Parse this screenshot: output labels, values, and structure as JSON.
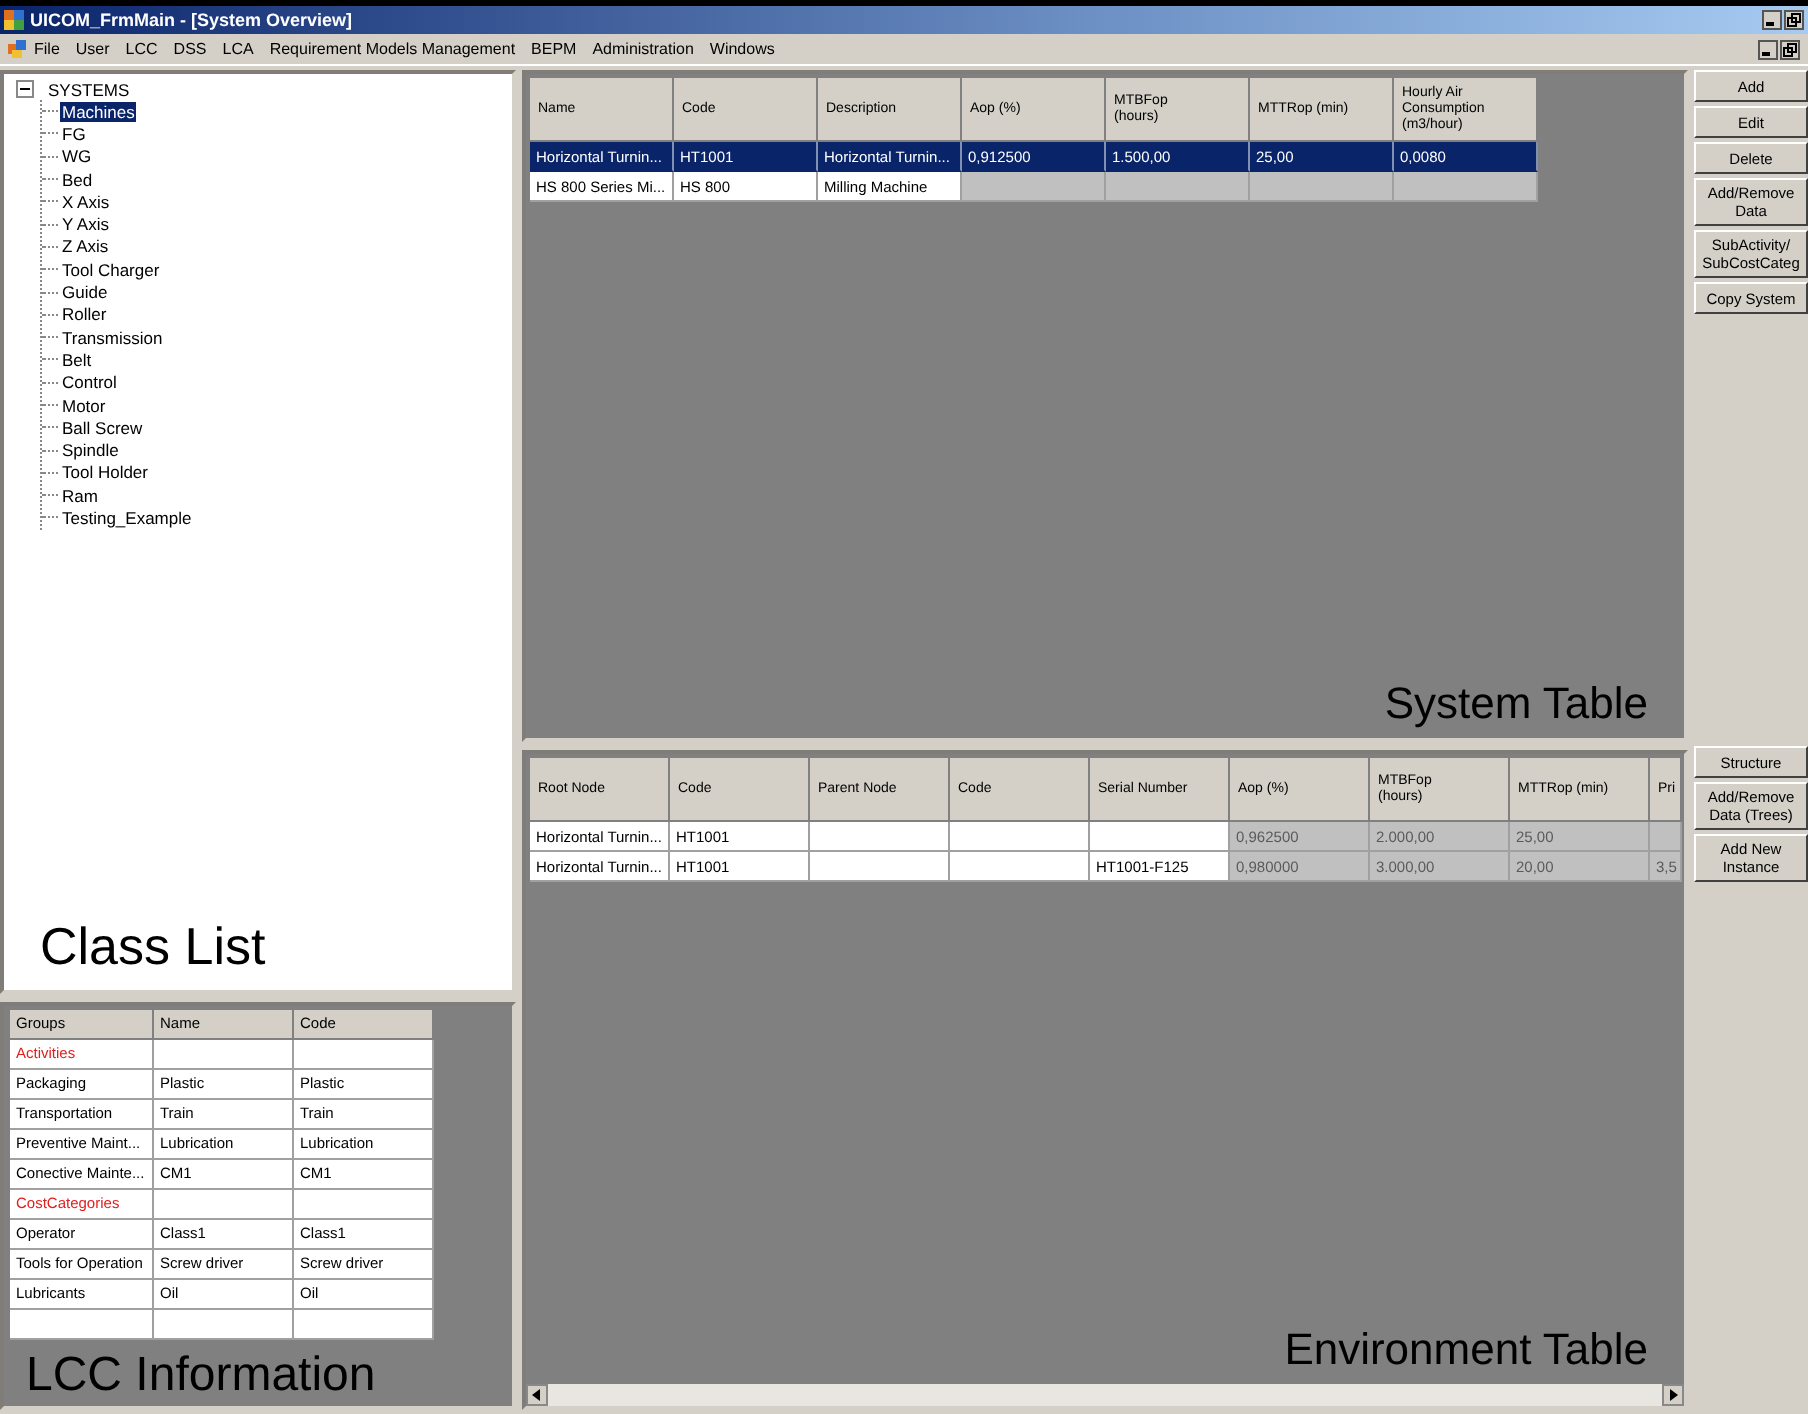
{
  "window": {
    "title": "UICOM_FrmMain - [System Overview]"
  },
  "menu": [
    "File",
    "User",
    "LCC",
    "DSS",
    "LCA",
    "Requirement Models Management",
    "BEPM",
    "Administration",
    "Windows"
  ],
  "class_list": {
    "label": "Class List",
    "tree": {
      "label": "SYSTEMS",
      "expanded": true,
      "children": [
        {
          "label": "Machines",
          "selected": true
        },
        {
          "label": "FG",
          "selected": false
        },
        {
          "label": "WG",
          "selected": false
        },
        {
          "label": "Bed",
          "selected": false
        },
        {
          "label": "X Axis",
          "selected": false
        },
        {
          "label": "Y Axis",
          "selected": false
        },
        {
          "label": "Z Axis",
          "selected": false
        },
        {
          "label": "Tool Charger",
          "selected": false
        },
        {
          "label": "Guide",
          "selected": false
        },
        {
          "label": "Roller",
          "selected": false
        },
        {
          "label": "Transmission",
          "selected": false
        },
        {
          "label": "Belt",
          "selected": false
        },
        {
          "label": "Control",
          "selected": false
        },
        {
          "label": "Motor",
          "selected": false
        },
        {
          "label": "Ball Screw",
          "selected": false
        },
        {
          "label": "Spindle",
          "selected": false
        },
        {
          "label": "Tool Holder",
          "selected": false
        },
        {
          "label": "Ram",
          "selected": false
        },
        {
          "label": "Testing_Example",
          "selected": false
        }
      ]
    }
  },
  "system_table": {
    "label": "System Table",
    "columns": [
      "Name",
      "Code",
      "Description",
      "Aop (%)",
      "MTBFop\n(hours)",
      "MTTRop (min)",
      "Hourly Air\nConsumption\n(m3/hour)"
    ],
    "rows": [
      {
        "selected": true,
        "cells": [
          {
            "text": "Horizontal Turnin...",
            "locked": false
          },
          {
            "text": "HT1001",
            "locked": false
          },
          {
            "text": "Horizontal Turnin...",
            "locked": false
          },
          {
            "text": "0,912500",
            "locked": false
          },
          {
            "text": "1.500,00",
            "locked": false
          },
          {
            "text": "25,00",
            "locked": false
          },
          {
            "text": "0,0080",
            "locked": false
          }
        ]
      },
      {
        "selected": false,
        "cells": [
          {
            "text": "HS 800 Series Mi...",
            "locked": false
          },
          {
            "text": "HS 800",
            "locked": false
          },
          {
            "text": "Milling Machine",
            "locked": false
          },
          {
            "locked": true
          },
          {
            "locked": true
          },
          {
            "locked": true
          },
          {
            "locked": true
          }
        ]
      }
    ]
  },
  "system_buttons": [
    "Add",
    "Edit",
    "Delete",
    "Add/Remove Data",
    "SubActivity/ SubCostCateg",
    "Copy System"
  ],
  "environment_table": {
    "label": "Environment Table",
    "columns": [
      "Root Node",
      "Code",
      "Parent Node",
      "Code",
      "Serial Number",
      "Aop (%)",
      "MTBFop\n(hours)",
      "MTTRop (min)",
      "Pri"
    ],
    "rows": [
      {
        "selected": false,
        "cells": [
          {
            "text": "Horizontal Turnin...",
            "locked": false
          },
          {
            "text": "HT1001",
            "locked": false
          },
          {
            "locked": false
          },
          {
            "locked": false
          },
          {
            "locked": false
          },
          {
            "text": "0,962500",
            "locked": true
          },
          {
            "text": "2.000,00",
            "locked": true
          },
          {
            "text": "25,00",
            "locked": true
          },
          {
            "locked": true
          }
        ]
      },
      {
        "selected": false,
        "cells": [
          {
            "text": "Horizontal Turnin...",
            "locked": false
          },
          {
            "text": "HT1001",
            "locked": false
          },
          {
            "locked": false
          },
          {
            "locked": false
          },
          {
            "text": "HT1001-F125",
            "locked": false
          },
          {
            "text": "0,980000",
            "locked": true
          },
          {
            "text": "3.000,00",
            "locked": true
          },
          {
            "text": "20,00",
            "locked": true
          },
          {
            "text": "3,5",
            "locked": true
          }
        ]
      }
    ]
  },
  "environment_buttons": [
    "Structure",
    "Add/Remove Data (Trees)",
    "Add New Instance"
  ],
  "lcc": {
    "label": "LCC Information",
    "columns": [
      "Groups",
      "Name",
      "Code"
    ],
    "rows": [
      {
        "kind": "category",
        "cells": [
          "Activities"
        ]
      },
      {
        "kind": "item",
        "cells": [
          "Packaging",
          "Plastic",
          "Plastic"
        ]
      },
      {
        "kind": "item",
        "cells": [
          "Transportation",
          "Train",
          "Train"
        ]
      },
      {
        "kind": "item",
        "cells": [
          "Preventive Maint...",
          "Lubrication",
          "Lubrication"
        ]
      },
      {
        "kind": "item",
        "cells": [
          "Conective Mainte...",
          "CM1",
          "CM1"
        ]
      },
      {
        "kind": "category",
        "cells": [
          "CostCategories"
        ]
      },
      {
        "kind": "item",
        "cells": [
          "Operator",
          "Class1",
          "Class1"
        ]
      },
      {
        "kind": "item",
        "cells": [
          "Tools for Operation",
          "Screw driver",
          "Screw driver"
        ]
      },
      {
        "kind": "item",
        "cells": [
          "Lubricants",
          "Oil",
          "Oil"
        ]
      }
    ]
  }
}
